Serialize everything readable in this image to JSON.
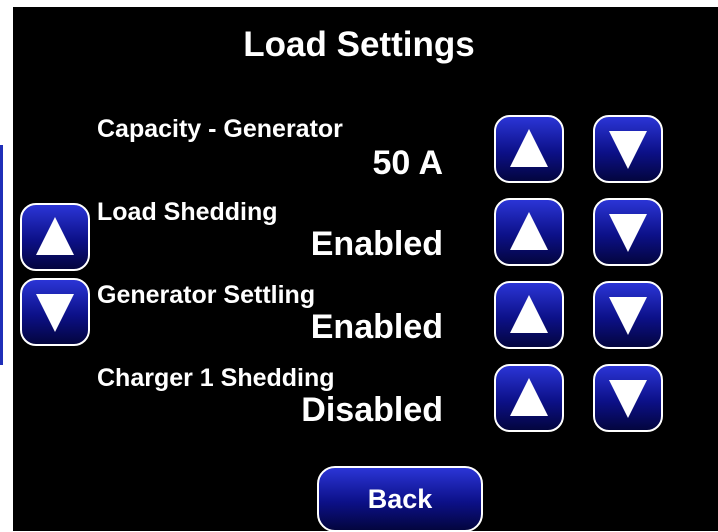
{
  "title": "Load Settings",
  "settings": [
    {
      "label": "Capacity - Generator",
      "value": "50 A"
    },
    {
      "label": "Load Shedding",
      "value": "Enabled"
    },
    {
      "label": "Generator Settling",
      "value": "Enabled"
    },
    {
      "label": "Charger 1 Shedding",
      "value": "Disabled"
    }
  ],
  "back_label": "Back",
  "colors": {
    "background": "#000000",
    "button_top": "#2b35d6",
    "button_bottom": "#03053e",
    "text": "#ffffff"
  },
  "icons": {
    "up": "triangle-up-icon",
    "down": "triangle-down-icon"
  }
}
